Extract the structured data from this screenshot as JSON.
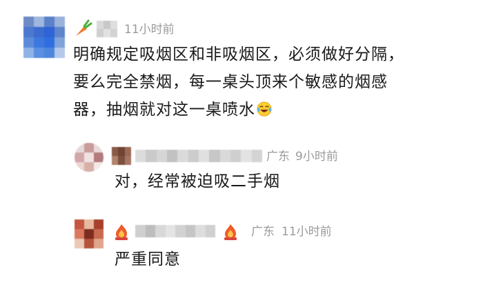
{
  "colors": {
    "name_blur": "#cfcfcf",
    "meta_text": "#9a9a9a",
    "body_text": "#191919"
  },
  "comments": [
    {
      "avatar": "blurred-blue-avatar",
      "badge_icon": "carrot-icon",
      "time": "11小时前",
      "text_lines": [
        "明确规定吸烟区和非吸烟区，必须做好分隔，",
        "要么完全禁烟，每一桌头顶来个敏感的烟感",
        "器，抽烟就对这一桌喷水"
      ],
      "trailing_emoji": "laughing-tears-emoji-icon"
    },
    {
      "avatar": "blurred-pink-avatar",
      "badge_icon": "brown-blurred-badge-icon",
      "location": "广东",
      "time": "9小时前",
      "text_lines": [
        "对，经常被迫吸二手烟"
      ]
    },
    {
      "avatar": "blurred-red-avatar",
      "badge_icon": "fire-badge-icon",
      "suffix_icon": "fire-badge-icon",
      "location": "广东",
      "time": "11小时前",
      "text_lines": [
        "严重同意"
      ]
    }
  ]
}
